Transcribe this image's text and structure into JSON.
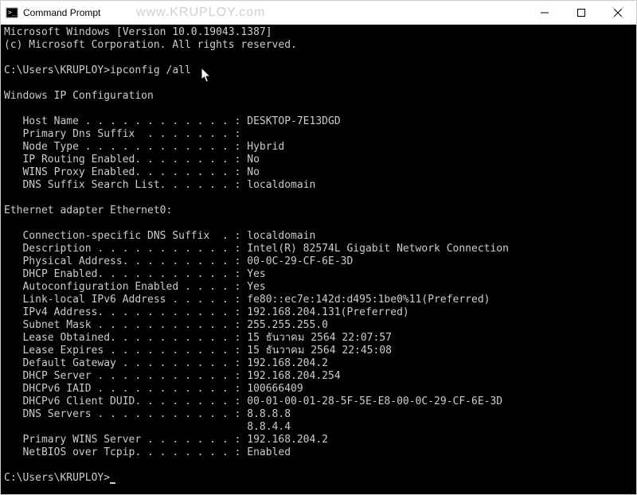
{
  "titlebar": {
    "title": "Command Prompt",
    "watermark": "www.KRUPLOY.com"
  },
  "terminal": {
    "header1": "Microsoft Windows [Version 10.0.19043.1387]",
    "header2": "(c) Microsoft Corporation. All rights reserved.",
    "prompt1_prefix": "C:\\Users\\KRUPLOY>",
    "command1": "ipconfig /all",
    "section1": "Windows IP Configuration",
    "ip_config": {
      "host_name": "   Host Name . . . . . . . . . . . . : DESKTOP-7E13DGD",
      "primary_dns_suffix": "   Primary Dns Suffix  . . . . . . . :",
      "node_type": "   Node Type . . . . . . . . . . . . : Hybrid",
      "ip_routing": "   IP Routing Enabled. . . . . . . . : No",
      "wins_proxy": "   WINS Proxy Enabled. . . . . . . . : No",
      "dns_suffix_list": "   DNS Suffix Search List. . . . . . : localdomain"
    },
    "section2": "Ethernet adapter Ethernet0:",
    "adapter": {
      "conn_dns": "   Connection-specific DNS Suffix  . : localdomain",
      "description": "   Description . . . . . . . . . . . : Intel(R) 82574L Gigabit Network Connection",
      "phys_addr": "   Physical Address. . . . . . . . . : 00-0C-29-CF-6E-3D",
      "dhcp_enabled": "   DHCP Enabled. . . . . . . . . . . : Yes",
      "autoconfig": "   Autoconfiguration Enabled . . . . : Yes",
      "link_local": "   Link-local IPv6 Address . . . . . : fe80::ec7e:142d:d495:1be0%11(Preferred)",
      "ipv4": "   IPv4 Address. . . . . . . . . . . : 192.168.204.131(Preferred)",
      "subnet": "   Subnet Mask . . . . . . . . . . . : 255.255.255.0",
      "lease_obtained": "   Lease Obtained. . . . . . . . . . : 15 ธันวาคม 2564 22:07:57",
      "lease_expires": "   Lease Expires . . . . . . . . . . : 15 ธันวาคม 2564 22:45:08",
      "gateway": "   Default Gateway . . . . . . . . . : 192.168.204.2",
      "dhcp_server": "   DHCP Server . . . . . . . . . . . : 192.168.204.254",
      "dhcpv6_iaid": "   DHCPv6 IAID . . . . . . . . . . . : 100666409",
      "dhcpv6_duid": "   DHCPv6 Client DUID. . . . . . . . : 00-01-00-01-28-5F-5E-E8-00-0C-29-CF-6E-3D",
      "dns_servers": "   DNS Servers . . . . . . . . . . . : 8.8.8.8",
      "dns_servers2": "                                       8.8.4.4",
      "primary_wins": "   Primary WINS Server . . . . . . . : 192.168.204.2",
      "netbios": "   NetBIOS over Tcpip. . . . . . . . : Enabled"
    },
    "prompt2_prefix": "C:\\Users\\KRUPLOY>"
  }
}
